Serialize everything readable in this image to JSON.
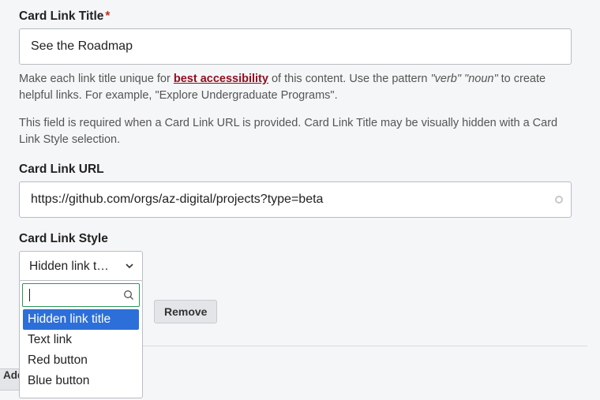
{
  "fields": {
    "title": {
      "label": "Card Link Title",
      "required_marker": "*",
      "value": "See the Roadmap"
    },
    "url": {
      "label": "Card Link URL",
      "value": "https://github.com/orgs/az-digital/projects?type=beta"
    },
    "style": {
      "label": "Card Link Style",
      "selected": "Hidden link t…",
      "options": [
        "Hidden link title",
        "Text link",
        "Red button",
        "Blue button"
      ]
    }
  },
  "help": {
    "line1_pre": "Make each link title unique for ",
    "line1_link": "best accessibility",
    "line1_mid": " of this content. Use the pattern ",
    "line1_em1": "\"verb\"",
    "line1_sp": " ",
    "line1_em2": "\"noun\"",
    "line1_post": " to create helpful links. For example, \"Explore Undergraduate Programs\".",
    "line2": "This field is required when a Card Link URL is provided. Card Link Title may be visually hidden with a Card Link Style selection."
  },
  "buttons": {
    "remove": "Remove",
    "add": "Add"
  }
}
